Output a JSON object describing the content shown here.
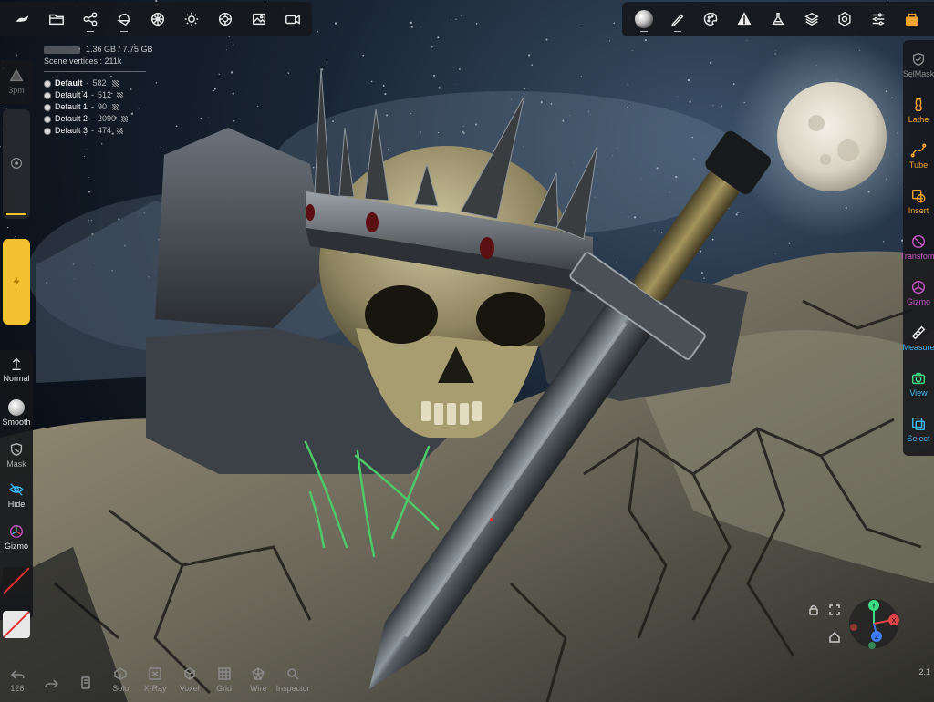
{
  "app": {
    "colors": {
      "accent": "#3db8f0",
      "brush": "#f2c230",
      "toolbar_bg": "#16181c"
    }
  },
  "top_left_toolbar": [
    {
      "name": "scene-menu-icon",
      "label": ""
    },
    {
      "name": "files-icon",
      "label": ""
    },
    {
      "name": "scene-graph-icon",
      "label": ""
    },
    {
      "name": "topology-icon",
      "label": ""
    },
    {
      "name": "material-icon",
      "label": ""
    },
    {
      "name": "lighting-icon",
      "label": ""
    },
    {
      "name": "environment-icon",
      "label": ""
    },
    {
      "name": "background-image-icon",
      "label": ""
    },
    {
      "name": "camera-icon",
      "label": ""
    }
  ],
  "top_right_toolbar": [
    {
      "name": "matcap-ball-icon"
    },
    {
      "name": "brush-stroke-icon"
    },
    {
      "name": "palette-icon"
    },
    {
      "name": "tool-settings-icon"
    },
    {
      "name": "flask-icon"
    },
    {
      "name": "layers-icon"
    },
    {
      "name": "gear-icon"
    },
    {
      "name": "sliders-icon"
    },
    {
      "name": "interface-icon"
    }
  ],
  "stats": {
    "memory": "1.36 GB / 7.75 GB",
    "vertices_label": "Scene vertices : 211k",
    "meshes": [
      {
        "name": "Default",
        "count": "582",
        "bold": true
      },
      {
        "name": "Default 4",
        "count": "512",
        "bold": false
      },
      {
        "name": "Default 1",
        "count": "90",
        "bold": false
      },
      {
        "name": "Default 2",
        "count": "2090",
        "bold": false
      },
      {
        "name": "Default 3",
        "count": "474",
        "bold": false
      }
    ]
  },
  "left_panel": {
    "radius_label": "3pm",
    "normal_label": "Normal",
    "smooth_label": "Smooth",
    "mask_label": "Mask",
    "hide_label": "Hide",
    "gizmo_label": "Gizmo"
  },
  "right_panel": [
    {
      "name": "selmask",
      "label": "SelMask",
      "icon": "selmask-icon",
      "color": "#8a8a8a"
    },
    {
      "name": "lathe",
      "label": "Lathe",
      "icon": "lathe-icon",
      "color": "#f2a531"
    },
    {
      "name": "tube",
      "label": "Tube",
      "icon": "tube-icon",
      "color": "#f2a531"
    },
    {
      "name": "insert",
      "label": "Insert",
      "icon": "insert-icon",
      "color": "#f2a531"
    },
    {
      "name": "transform",
      "label": "Transform",
      "icon": "transform-icon",
      "color": "#c455c4"
    },
    {
      "name": "gizmo",
      "label": "Gizmo",
      "icon": "gizmo-icon",
      "color": "#c455c4"
    },
    {
      "name": "measure",
      "label": "Measure",
      "icon": "measure-icon",
      "color": "#3db8f0"
    },
    {
      "name": "view",
      "label": "View",
      "icon": "view-icon",
      "color": "#3ddc84"
    },
    {
      "name": "select",
      "label": "Select",
      "icon": "select-icon",
      "color": "#3db8f0"
    }
  ],
  "bottom_bar": {
    "undo_count": "126",
    "items": [
      {
        "name": "undo-button",
        "label": "126",
        "icon": "undo-icon"
      },
      {
        "name": "redo-button",
        "label": "",
        "icon": "redo-icon"
      },
      {
        "name": "mesh-button",
        "label": "",
        "icon": "mesh-icon"
      },
      {
        "name": "solo-button",
        "label": "Solo",
        "icon": "solo-icon"
      },
      {
        "name": "xray-button",
        "label": "X-Ray",
        "icon": "xray-icon"
      },
      {
        "name": "voxel-button",
        "label": "Voxel",
        "icon": "voxel-icon"
      },
      {
        "name": "grid-button",
        "label": "Grid",
        "icon": "grid-icon"
      },
      {
        "name": "wire-button",
        "label": "Wire",
        "icon": "wire-icon"
      },
      {
        "name": "inspector-button",
        "label": "Inspector",
        "icon": "inspector-icon"
      }
    ]
  },
  "axis_gizmo": {
    "x": "X",
    "y": "Y",
    "z": "Z"
  },
  "version": "2.1"
}
